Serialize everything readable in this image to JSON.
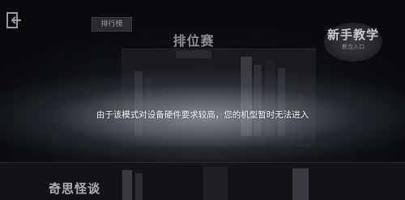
{
  "header": {
    "back_icon": "back-door-icon"
  },
  "menu": {
    "leaderboard_label": "排行榜",
    "ranked_match_label": "排位赛",
    "tutorial_label": "新手教学",
    "tutorial_sublabel": "教合入口",
    "strange_tales_label": "奇思怪谈"
  },
  "toast": {
    "message": "由于该模式对设备硬件要求较高，您的机型暂时无法进入"
  }
}
